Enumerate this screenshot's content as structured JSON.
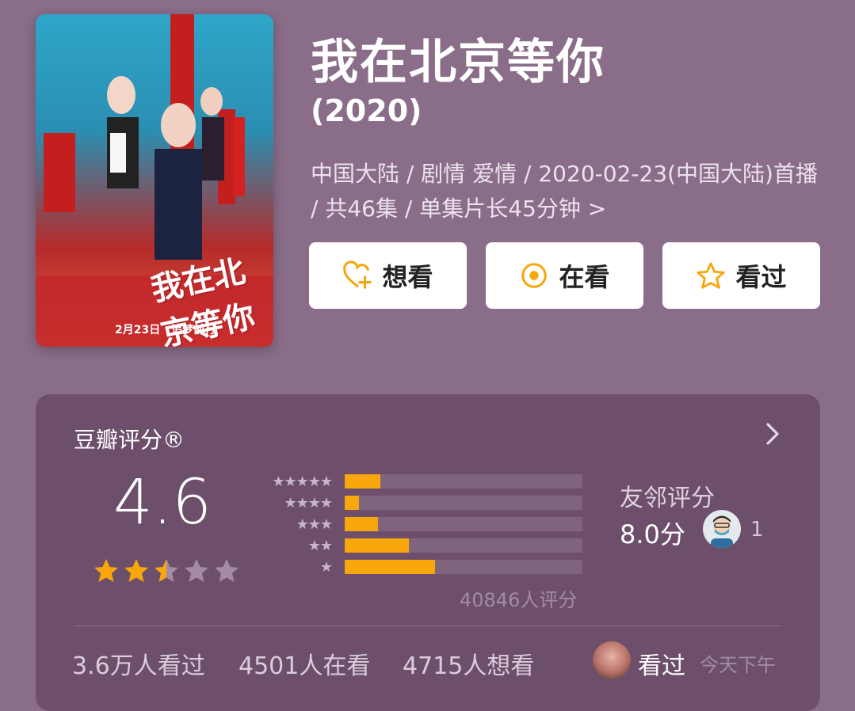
{
  "poster": {
    "title_text": "我在北京等你",
    "date_text": "2月23日　追梦前行"
  },
  "title": "我在北京等你",
  "year": "(2020)",
  "meta": "中国大陆 / 剧情 爱情 / 2020-02-23(中国大陆)首播 / 共46集 / 单集片长45分钟 >",
  "buttons": [
    {
      "label": "想看",
      "icon": "heart-plus-icon"
    },
    {
      "label": "在看",
      "icon": "target-icon"
    },
    {
      "label": "看过",
      "icon": "star-icon"
    }
  ],
  "accent": "#f7a70c",
  "rating": {
    "title": "豆瓣评分®",
    "score": "4.6",
    "star_level": 2.5,
    "count_label": "40846人评分",
    "distribution": [
      {
        "stars": "★★★★★",
        "fraction": 0.15
      },
      {
        "stars": "★★★★",
        "fraction": 0.06
      },
      {
        "stars": "★★★",
        "fraction": 0.14
      },
      {
        "stars": "★★",
        "fraction": 0.27
      },
      {
        "stars": "★",
        "fraction": 0.38
      }
    ],
    "friend_label": "友邻评分",
    "friend_score": "8.0分",
    "friend_count": "1"
  },
  "bottom": {
    "watched": "3.6万人看过",
    "watching": "4501人在看",
    "want": "4715人想看",
    "status": "看过",
    "time": "今天下午"
  }
}
